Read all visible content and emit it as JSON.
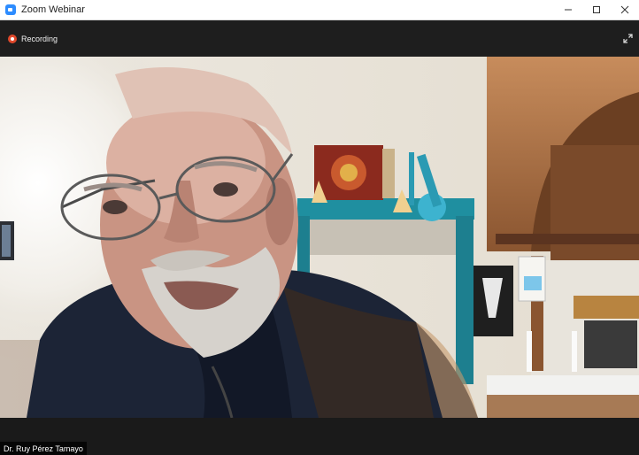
{
  "window": {
    "title": "Zoom Webinar",
    "controls": [
      "minimize-icon",
      "maximize-icon",
      "close-icon"
    ]
  },
  "toolbar": {
    "recording_label": "Recording",
    "recording_icon": "record-icon",
    "fullscreen_icon": "fullscreen-icon"
  },
  "video": {
    "participant_name": "Dr. Ruy Pérez Tamayo"
  },
  "colors": {
    "zoom_blue": "#2d8cff",
    "recording_red": "#e0482b",
    "toolbar_bg": "#1e1e1e"
  }
}
